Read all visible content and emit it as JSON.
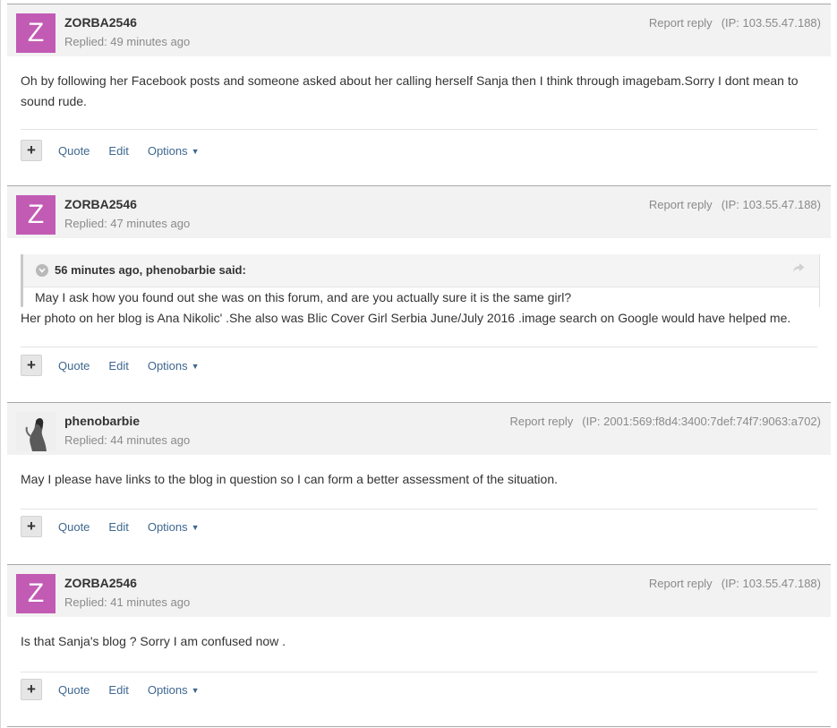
{
  "posts": [
    {
      "username": "ZORBA2546",
      "avatar_letter": "Z",
      "avatar_color": "#c25bb4",
      "replied": "Replied: 49 minutes ago",
      "report": "Report reply",
      "ip": "(IP: 103.55.47.188)",
      "message": "Oh by following her Facebook posts and someone asked about her calling herself Sanja then I think through imagebam.Sorry I dont mean to sound rude."
    },
    {
      "username": "ZORBA2546",
      "avatar_letter": "Z",
      "avatar_color": "#c25bb4",
      "replied": "Replied: 47 minutes ago",
      "report": "Report reply",
      "ip": "(IP: 103.55.47.188)",
      "quote": {
        "header": "56 minutes ago, phenobarbie said:",
        "text": "May I ask how you found out she was on this forum, and are you actually sure it is the same girl?"
      },
      "message": "Her photo on her blog is Ana Nikolic' .She also was Blic Cover Girl Serbia June/July 2016 .image search on Google would have helped me."
    },
    {
      "username": "phenobarbie",
      "avatar_letter": "",
      "replied": "Replied: 44 minutes ago",
      "report": "Report reply",
      "ip": "(IP: 2001:569:f8d4:3400:7def:74f7:9063:a702)",
      "message": "May I please have links to the blog in question so I can form a better assessment of the situation."
    },
    {
      "username": "ZORBA2546",
      "avatar_letter": "Z",
      "avatar_color": "#c25bb4",
      "replied": "Replied: 41 minutes ago",
      "report": "Report reply",
      "ip": "(IP: 103.55.47.188)",
      "message": "Is that Sanja's blog ? Sorry I am confused now ."
    }
  ],
  "actions": {
    "plus": "+",
    "quote": "Quote",
    "edit": "Edit",
    "options": "Options",
    "options_caret": "▼"
  },
  "icons": {
    "share": "share-icon",
    "chevron": "chevron-down-icon",
    "add": "plus-icon"
  },
  "colors": {
    "avatar_bg": "#c25bb4",
    "link": "#3e6790",
    "muted": "#8a8a8a",
    "header_bg": "#f2f2f2"
  }
}
